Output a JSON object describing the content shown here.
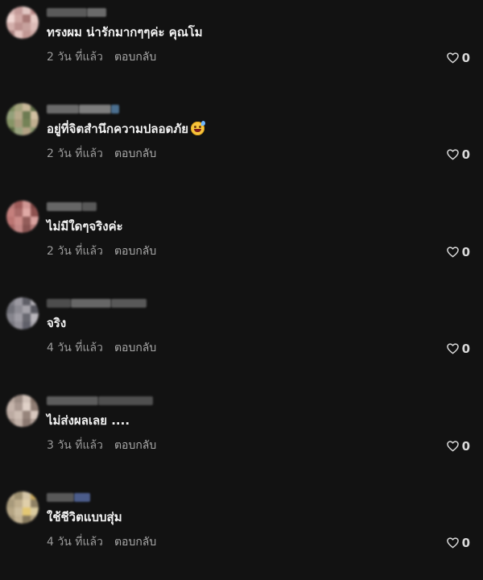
{
  "comments": [
    {
      "text": "ทรงผม น่ารักมากๆๆค่ะ คุณโม",
      "time": "2 วัน ที่แล้ว",
      "reply": "ตอบกลับ",
      "likes": "0",
      "emoji": ""
    },
    {
      "text": "อยู่ที่จิตสำนึกความปลอดภัย",
      "time": "2 วัน ที่แล้ว",
      "reply": "ตอบกลับ",
      "likes": "0",
      "emoji": "grinning-sweat-emoji"
    },
    {
      "text": "ไม่มีใดๆจริงค่ะ",
      "time": "2 วัน ที่แล้ว",
      "reply": "ตอบกลับ",
      "likes": "0",
      "emoji": ""
    },
    {
      "text": "จริง",
      "time": "4 วัน ที่แล้ว",
      "reply": "ตอบกลับ",
      "likes": "0",
      "emoji": ""
    },
    {
      "text": "ไม่ส่งผลเลย ....",
      "time": "3 วัน ที่แล้ว",
      "reply": "ตอบกลับ",
      "likes": "0",
      "emoji": ""
    },
    {
      "text": "ใช้ชีวิตแบบสุ่ม",
      "time": "4 วัน ที่แล้ว",
      "reply": "ตอบกลับ",
      "likes": "0",
      "emoji": ""
    }
  ],
  "icons": {
    "like": "heart-outline-icon"
  },
  "colors": {
    "background": "#121212",
    "text": "#f2f2f2",
    "meta": "#9a9a9a"
  }
}
